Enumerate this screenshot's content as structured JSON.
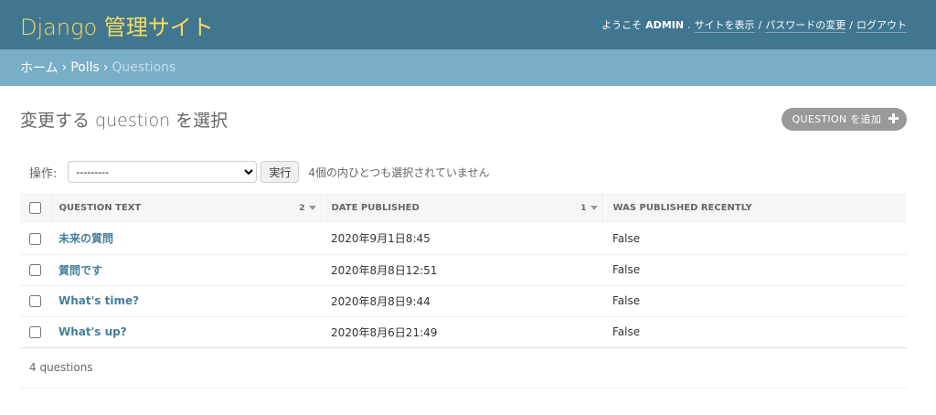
{
  "header": {
    "branding": "Django 管理サイト",
    "welcome": "ようこそ",
    "username": "ADMIN",
    "period": ".",
    "links": [
      "サイトを表示",
      "パスワードの変更",
      "ログアウト"
    ],
    "separator": "/"
  },
  "breadcrumbs": {
    "home": "ホーム",
    "app": "Polls",
    "current": "Questions",
    "arrow": "›"
  },
  "page": {
    "title": "変更する question を選択",
    "add_button": "QUESTION を追加"
  },
  "actions": {
    "label": "操作:",
    "selected_option": "---------",
    "go_button": "実行",
    "counter": "4個の内ひとつも選択されていません"
  },
  "table": {
    "columns": [
      {
        "label": "Question text",
        "sort_priority": "2"
      },
      {
        "label": "Date published",
        "sort_priority": "1"
      },
      {
        "label": "Was published recently"
      }
    ],
    "rows": [
      {
        "question_text": "未来の質問",
        "date_published": "2020年9月1日8:45",
        "was_published_recently": "False"
      },
      {
        "question_text": "質問です",
        "date_published": "2020年8月8日12:51",
        "was_published_recently": "False"
      },
      {
        "question_text": "What's time?",
        "date_published": "2020年8月8日9:44",
        "was_published_recently": "False"
      },
      {
        "question_text": "What's up?",
        "date_published": "2020年8月6日21:49",
        "was_published_recently": "False"
      }
    ]
  },
  "paginator": {
    "text": "4 questions"
  },
  "colors": {
    "header_bg": "#417690",
    "branding": "#f5dd5d",
    "breadcrumbs_bg": "#79aec8",
    "link": "#447e9b"
  }
}
